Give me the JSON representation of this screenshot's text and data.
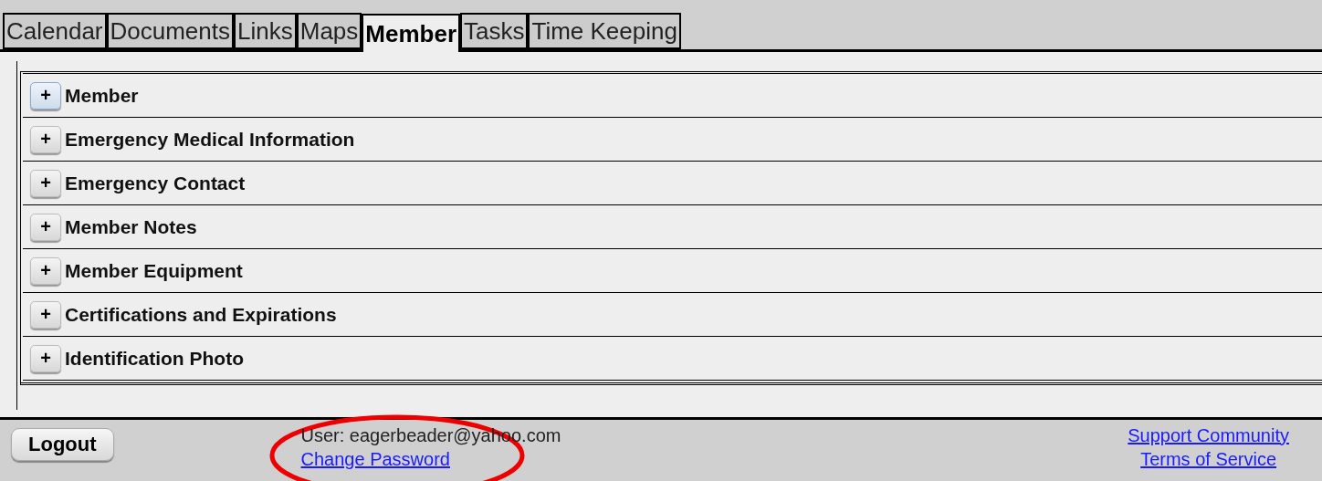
{
  "tabs": [
    {
      "label": "Calendar",
      "selected": false
    },
    {
      "label": "Documents",
      "selected": false
    },
    {
      "label": "Links",
      "selected": false
    },
    {
      "label": "Maps",
      "selected": false
    },
    {
      "label": "Member",
      "selected": true
    },
    {
      "label": "Tasks",
      "selected": false
    },
    {
      "label": "Time Keeping",
      "selected": false
    }
  ],
  "sections": [
    {
      "toggle": "+",
      "title": "Member",
      "focused": true
    },
    {
      "toggle": "+",
      "title": "Emergency Medical Information",
      "focused": false
    },
    {
      "toggle": "+",
      "title": "Emergency Contact",
      "focused": false
    },
    {
      "toggle": "+",
      "title": "Member Notes",
      "focused": false
    },
    {
      "toggle": "+",
      "title": "Member Equipment",
      "focused": false
    },
    {
      "toggle": "+",
      "title": "Certifications and Expirations",
      "focused": false
    },
    {
      "toggle": "+",
      "title": "Identification Photo",
      "focused": false
    }
  ],
  "footer": {
    "logout": "Logout",
    "user": "User: eagerbeader@yahoo.com",
    "change_password": "Change Password",
    "links": [
      "Support Community",
      "Terms of Service"
    ]
  }
}
